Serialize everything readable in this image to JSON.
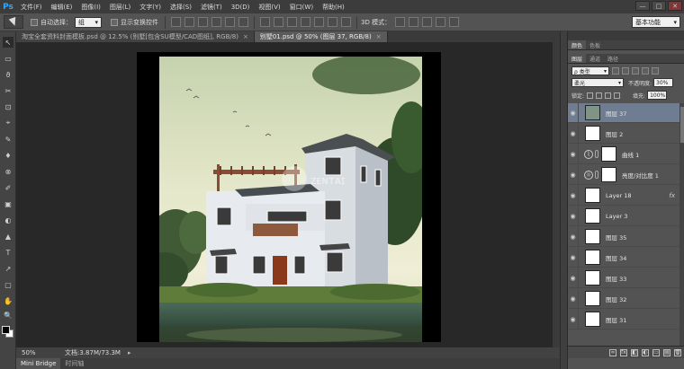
{
  "app": {
    "logo": "Ps"
  },
  "menu": [
    "文件(F)",
    "编辑(E)",
    "图像(I)",
    "图层(L)",
    "文字(Y)",
    "选择(S)",
    "滤镜(T)",
    "3D(D)",
    "视图(V)",
    "窗口(W)",
    "帮助(H)"
  ],
  "window_controls": {
    "minimize": "—",
    "maximize": "□",
    "close": "✕"
  },
  "options": {
    "auto_select_label": "自动选择：",
    "auto_select_value": "组",
    "show_transform_label": "显示变换控件",
    "mode_3d_label": "3D 模式：",
    "workspace": "基本功能"
  },
  "tabs": [
    {
      "label": "淘宝全套资料封面模板.psd @ 12.5% (别墅[包含SU模型/CAD图纸], RGB/8)",
      "active": false,
      "close": "×"
    },
    {
      "label": "别墅01.psd @ 50% (图层 37, RGB/8)",
      "active": true,
      "close": "×"
    }
  ],
  "status": {
    "zoom": "50%",
    "doc_size": "文档:3.87M/73.3M",
    "arrow": "▸"
  },
  "bottom_tabs": [
    "Mini Bridge",
    "时间轴"
  ],
  "panel": {
    "top_tabs": [
      "颜色",
      "色板"
    ],
    "tabs": [
      "图层",
      "通道",
      "路径"
    ],
    "filter_kind": "ρ 类型",
    "blend_mode": "柔光",
    "opacity_label": "不透明度:",
    "opacity_value": "30%",
    "lock_label": "锁定:",
    "fill_label": "填充:",
    "fill_value": "100%"
  },
  "layers": [
    {
      "name": "图层 37",
      "selected": true,
      "thumb": "image",
      "eye": "◉"
    },
    {
      "name": "图层 2",
      "selected": false,
      "thumb": "white",
      "eye": "◉"
    },
    {
      "name": "曲线 1",
      "selected": false,
      "thumb": "adjust",
      "adj": "⌇",
      "eye": "◉"
    },
    {
      "name": "亮度/对比度 1",
      "selected": false,
      "thumb": "adjust",
      "adj": "☼",
      "eye": "◉"
    },
    {
      "name": "Layer 18",
      "selected": false,
      "thumb": "white",
      "fx": "fx",
      "eye": "◉"
    },
    {
      "name": "Layer 3",
      "selected": false,
      "thumb": "white",
      "eye": "◉"
    },
    {
      "name": "图层 35",
      "selected": false,
      "thumb": "white",
      "eye": "◉"
    },
    {
      "name": "图层 34",
      "selected": false,
      "thumb": "white",
      "eye": "◉"
    },
    {
      "name": "图层 33",
      "selected": false,
      "thumb": "white",
      "eye": "◉"
    },
    {
      "name": "图层 32",
      "selected": false,
      "thumb": "white",
      "eye": "◉"
    },
    {
      "name": "图层 31",
      "selected": false,
      "thumb": "white",
      "eye": "◉"
    }
  ],
  "footer_icons": [
    "∞",
    "fx",
    "◧",
    "◐",
    "▭",
    "▤",
    "🗑"
  ],
  "tools": [
    "↖",
    "▭",
    "ϑ",
    "✂",
    "⊡",
    "⌖",
    "✎",
    "♦",
    "⊗",
    "✐",
    "▣",
    "◐",
    "▲",
    "T",
    "↗",
    "▢",
    "✋",
    "🔍"
  ]
}
